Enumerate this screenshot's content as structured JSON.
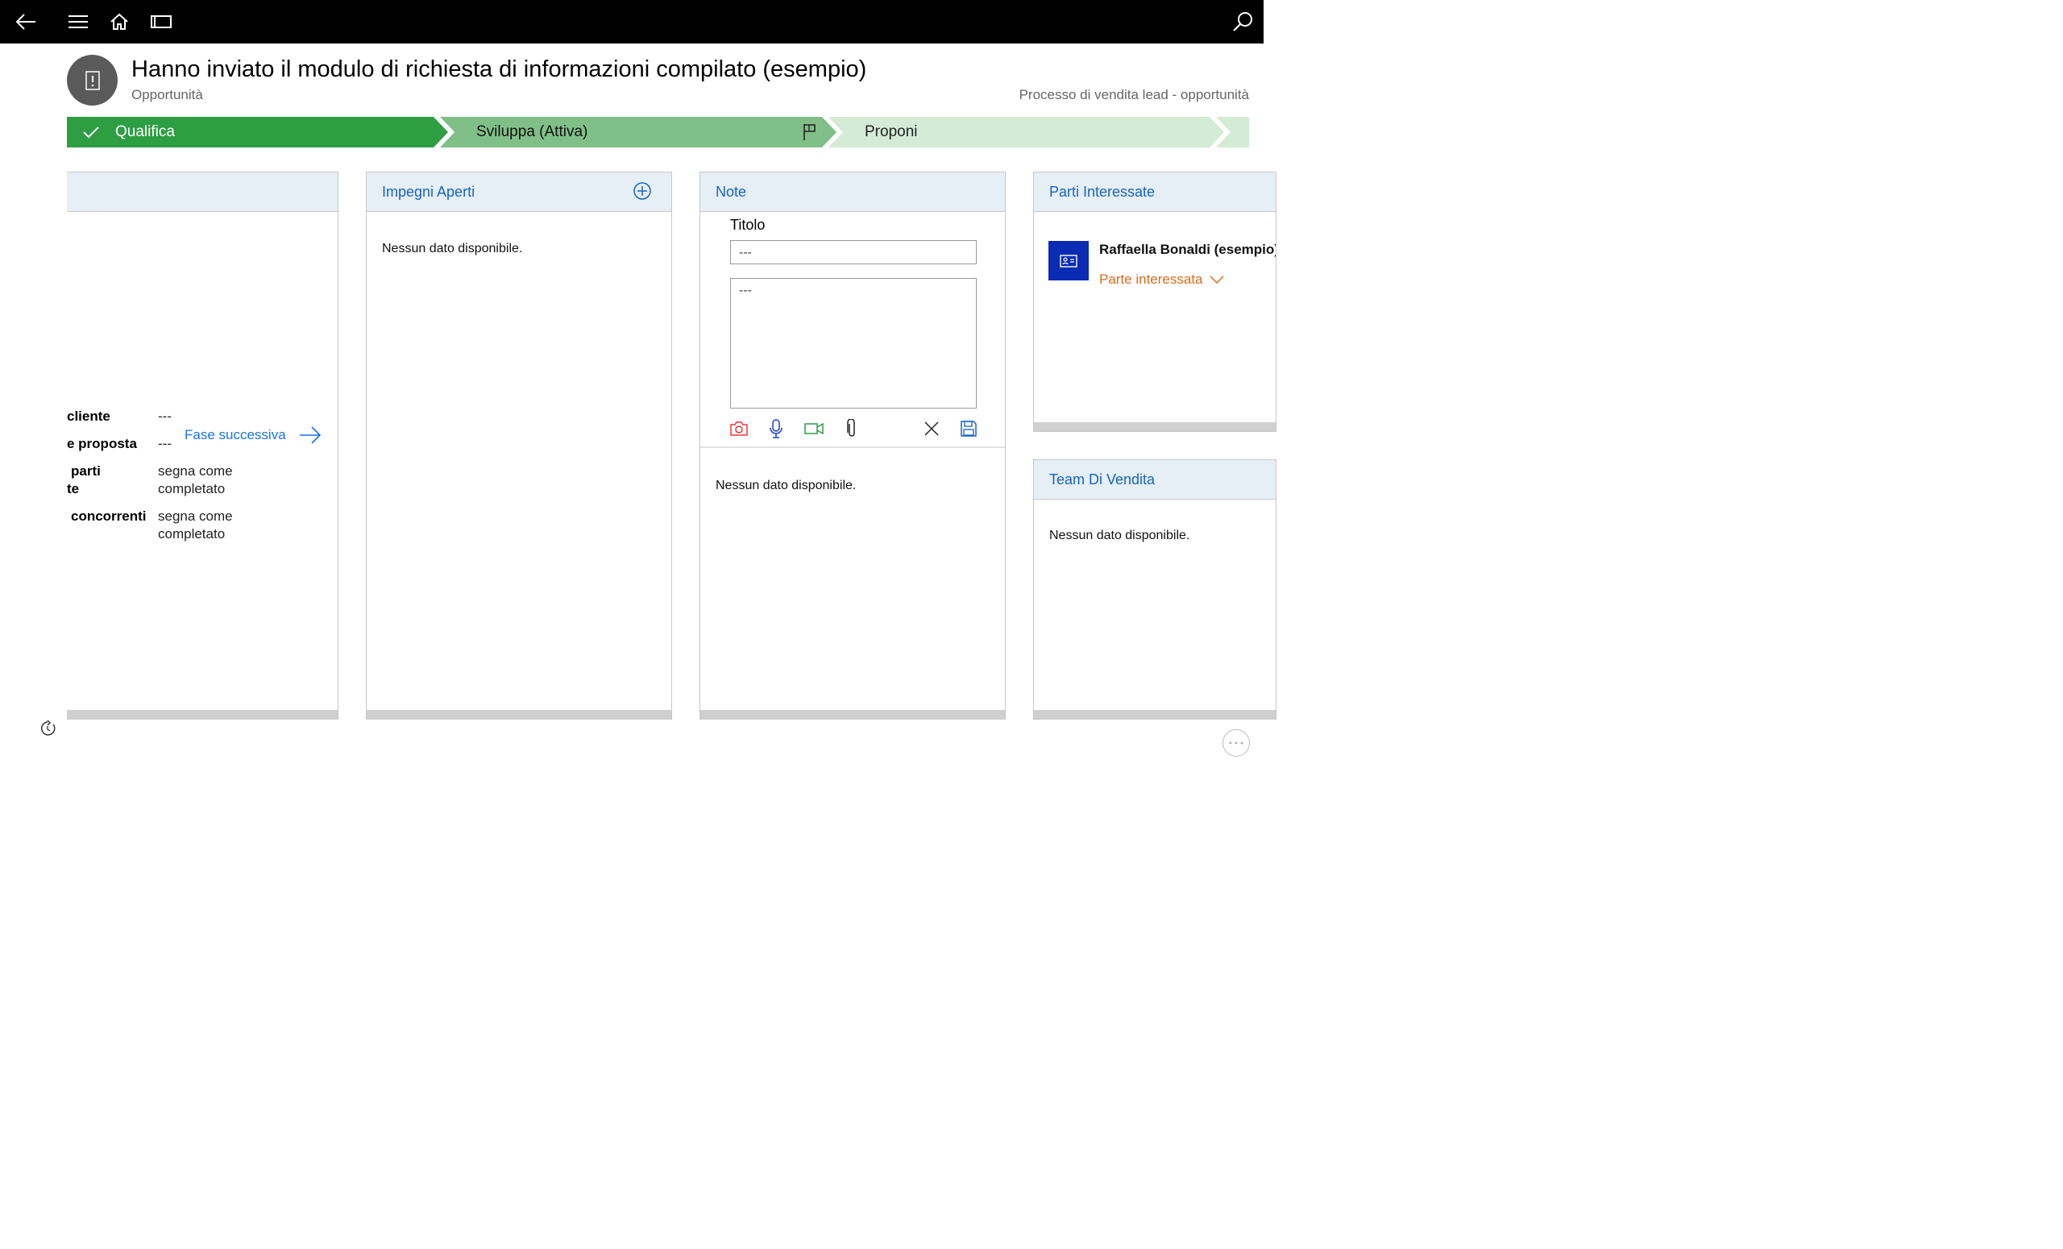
{
  "nav": {
    "back_icon": "back-arrow-icon",
    "menu_icon": "hamburger-menu-icon",
    "home_icon": "home-icon",
    "panel_icon": "panel-toggle-icon",
    "search_icon": "search-icon"
  },
  "record": {
    "title": "Hanno inviato il modulo di richiesta di informazioni compilato (esempio)",
    "entity": "Opportunità",
    "process": "Processo di vendita lead - opportunità",
    "avatar_icon": "opportunity-icon"
  },
  "stages": [
    {
      "label": "Qualifica",
      "state": "completed",
      "color": "#2e9e43"
    },
    {
      "label": "Sviluppa (Attiva)",
      "state": "active",
      "color": "#81bf88"
    },
    {
      "label": "Proponi",
      "state": "upcoming",
      "color": "#d4ebd6"
    }
  ],
  "stage_panel": {
    "fields": [
      {
        "label": "cliente",
        "value": "---"
      },
      {
        "label": "e proposta",
        "value": "---"
      },
      {
        "label_line1": "parti",
        "label_line2": "te",
        "value_line1": "segna come",
        "value_line2": "completato"
      },
      {
        "label": "concorrenti",
        "value_line1": "segna come",
        "value_line2": "completato"
      }
    ],
    "next_stage": "Fase successiva"
  },
  "impegni": {
    "title": "Impegni Aperti",
    "empty": "Nessun dato disponibile."
  },
  "note": {
    "title": "Note",
    "title_label": "Titolo",
    "title_value": "---",
    "body_value": "---",
    "empty": "Nessun dato disponibile."
  },
  "parti": {
    "title": "Parti Interessate",
    "contact_name": "Raffaella Bonaldi (esempio)",
    "contact_role": "Parte interessata"
  },
  "team": {
    "title": "Team Di Vendita",
    "empty": "Nessun dato disponibile."
  },
  "colors": {
    "accent": "#1565c0",
    "role": "#d86c1a",
    "header_bg": "#e6eef6"
  }
}
